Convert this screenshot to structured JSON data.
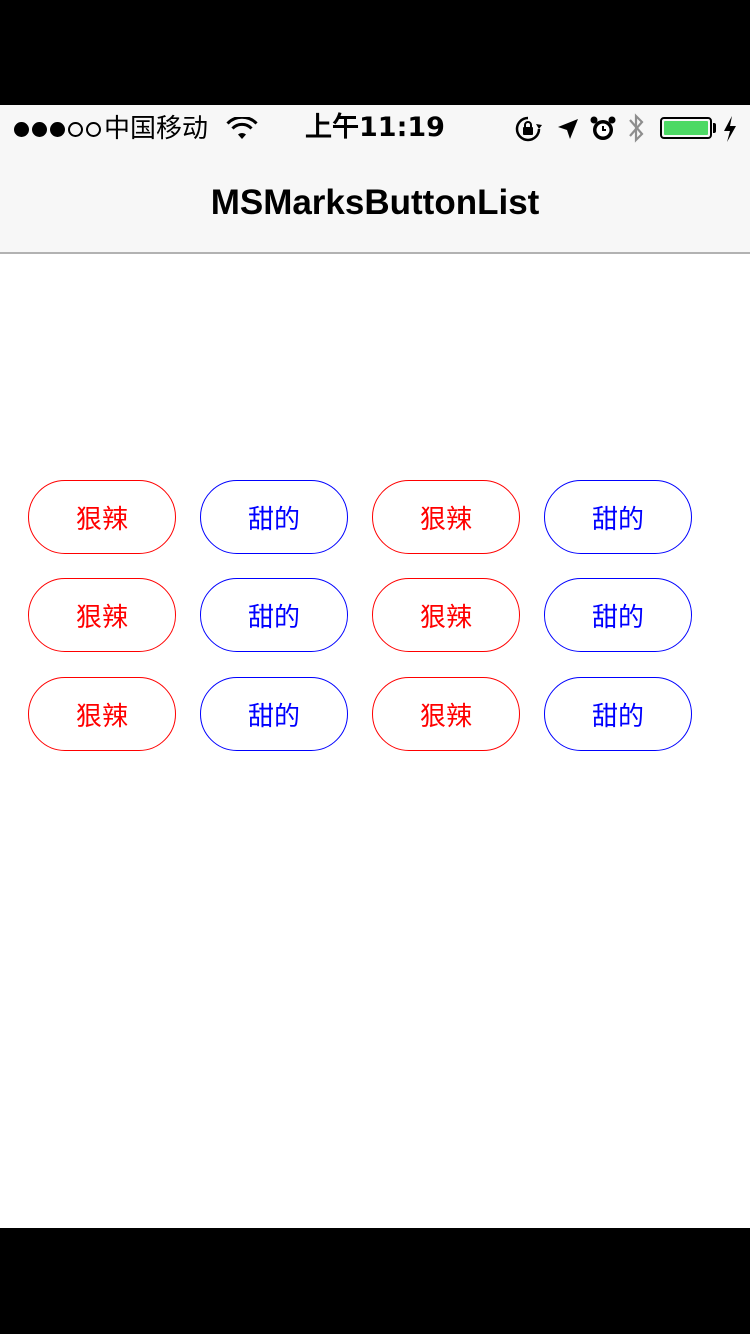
{
  "status_bar": {
    "signal_dots_filled": 3,
    "signal_dots_total": 5,
    "carrier": "中国移动",
    "time": "上午11:19",
    "battery_level": 1.0,
    "battery_color": "#4cd964",
    "icons": [
      "wifi-icon",
      "orientation-lock-icon",
      "location-arrow-icon",
      "alarm-icon",
      "bluetooth-icon",
      "battery-icon",
      "charging-bolt-icon"
    ]
  },
  "nav": {
    "title": "MSMarksButtonList"
  },
  "marks": {
    "colors": {
      "red": "#ff0000",
      "blue": "#0000ff"
    },
    "rows": [
      [
        {
          "label": "狠辣",
          "color": "red"
        },
        {
          "label": "甜的",
          "color": "blue"
        },
        {
          "label": "狠辣",
          "color": "red"
        },
        {
          "label": "甜的",
          "color": "blue"
        }
      ],
      [
        {
          "label": "狠辣",
          "color": "red"
        },
        {
          "label": "甜的",
          "color": "blue"
        },
        {
          "label": "狠辣",
          "color": "red"
        },
        {
          "label": "甜的",
          "color": "blue"
        }
      ],
      [
        {
          "label": "狠辣",
          "color": "red"
        },
        {
          "label": "甜的",
          "color": "blue"
        },
        {
          "label": "狠辣",
          "color": "red"
        },
        {
          "label": "甜的",
          "color": "blue"
        }
      ]
    ]
  }
}
